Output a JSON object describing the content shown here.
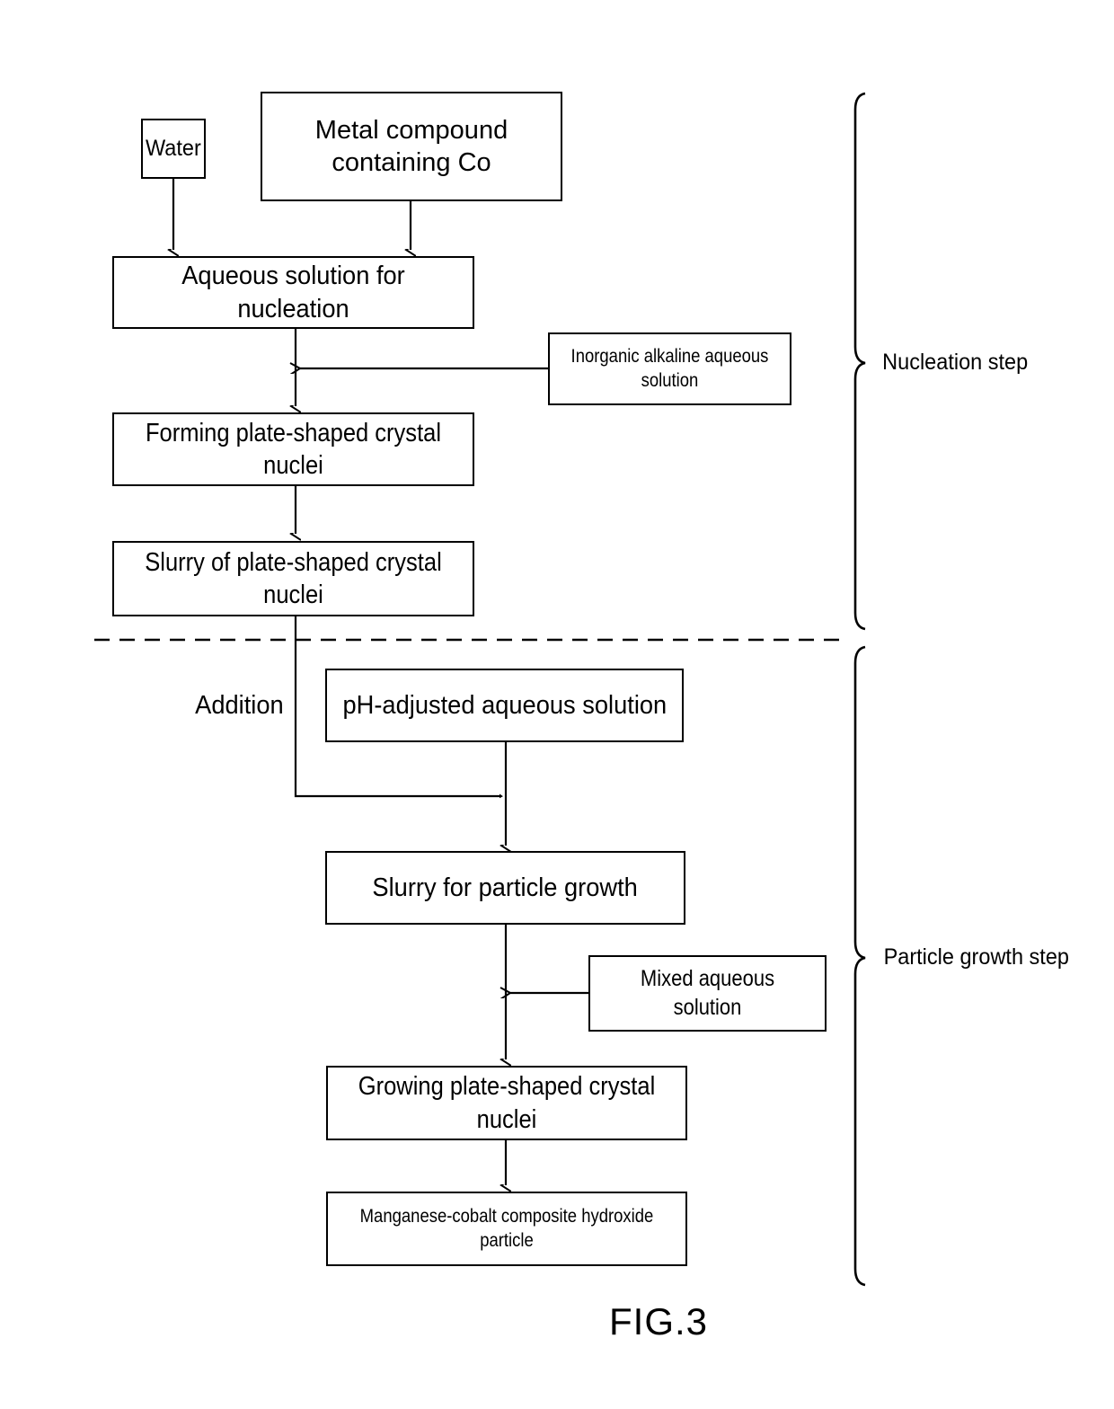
{
  "figure": {
    "caption": "FIG.3",
    "type": "process-flowchart"
  },
  "nodes": {
    "water": "Water",
    "metal_compound": "Metal compound\ncontaining Co",
    "aqueous_nucleation": "Aqueous solution for nucleation",
    "inorganic_alkaline": "Inorganic alkaline aqueous solution",
    "forming_nuclei": "Forming plate-shaped crystal nuclei",
    "slurry_nuclei": "Slurry of plate-shaped crystal nuclei",
    "ph_adjusted": "pH-adjusted aqueous solution",
    "slurry_growth": "Slurry for particle growth",
    "mixed_aqueous": "Mixed aqueous solution",
    "growing_nuclei": "Growing plate-shaped crystal nuclei",
    "final_product": "Manganese-cobalt composite hydroxide particle"
  },
  "annotations": {
    "addition": "Addition"
  },
  "braces": {
    "nucleation_step": "Nucleation step",
    "particle_growth_step": "Particle growth step"
  },
  "colors": {
    "line": "#000000",
    "background": "#ffffff"
  }
}
